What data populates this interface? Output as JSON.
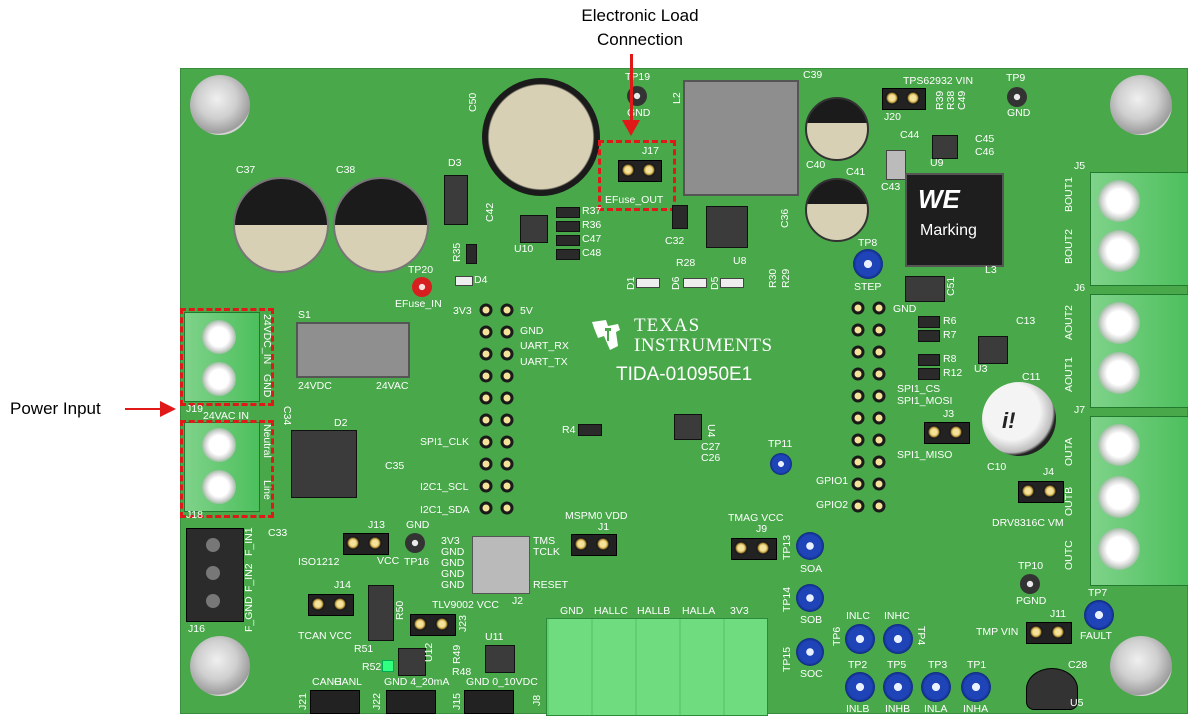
{
  "annotations": {
    "electronic_load_line1": "Electronic Load",
    "electronic_load_line2": "Connection",
    "power_input": "Power Input"
  },
  "board": {
    "vendor_line1": "TEXAS",
    "vendor_line2": "INSTRUMENTS",
    "board_id": "TIDA-010950E1",
    "inductor_brand": "WE",
    "inductor_marking": "Marking",
    "cap_logo": "i!"
  },
  "silkscreen": {
    "C37": "C37",
    "C38": "C38",
    "C50": "C50",
    "D3": "D3",
    "TP19": "TP19",
    "GND_tp19": "GND",
    "L2": "L2",
    "C39": "C39",
    "TPS62932_VIN": "TPS62932 VIN",
    "TP9": "TP9",
    "GND_tp9": "GND",
    "J20": "J20",
    "R39": "R39",
    "R38": "R38",
    "C49": "C49",
    "C44": "C44",
    "C45": "C45",
    "C46": "C46",
    "U9": "U9",
    "C40": "C40",
    "C41": "C41",
    "C43": "C43",
    "J17": "J17",
    "EFuse_OUT": "EFuse_OUT",
    "C42": "C42",
    "R37": "R37",
    "R36": "R36",
    "C47": "C47",
    "C48": "C48",
    "U10": "U10",
    "C32": "C32",
    "C36": "C36",
    "U8": "U8",
    "R28": "R28",
    "R30": "R30",
    "R29": "R29",
    "TP8": "TP8",
    "STEP": "STEP",
    "L3": "L3",
    "C51": "C51",
    "R35": "R35",
    "D4": "D4",
    "TP20": "TP20",
    "EFuse_IN": "EFuse_IN",
    "D1": "D1",
    "D6": "D6",
    "D5": "D5",
    "J5": "J5",
    "BOUT1": "BOUT1",
    "BOUT2": "BOUT2",
    "J6": "J6",
    "AOUT2": "AOUT2",
    "AOUT1": "AOUT1",
    "J7": "J7",
    "OUTA": "OUTA",
    "OUTB": "OUTB",
    "OUTC": "OUTC",
    "S1": "S1",
    "24VDC": "24VDC",
    "24VAC": "24VAC",
    "24VDC_IN": "24VDC_IN",
    "GND_J19": "GND",
    "J19": "J19",
    "24VAC_IN": "24VAC IN",
    "Neutral": "Neutral",
    "Line": "Line",
    "J18": "J18",
    "C34": "C34",
    "D2": "D2",
    "C35": "C35",
    "C33": "C33",
    "3V3": "3V3",
    "5V": "5V",
    "GND_hdr": "GND",
    "UART_RX": "UART_RX",
    "UART_TX": "UART_TX",
    "SPI1_CLK": "SPI1_CLK",
    "I2C1_SCL": "I2C1_SCL",
    "I2C1_SDA": "I2C1_SDA",
    "R4": "R4",
    "U4": "U4",
    "C27": "C27",
    "C26": "C26",
    "TP11": "TP11",
    "GND_right": "GND",
    "R6": "R6",
    "R7": "R7",
    "R8": "R8",
    "R12": "R12",
    "C13": "C13",
    "U3": "U3",
    "C11": "C11",
    "SPI1_CS": "SPI1_CS",
    "SPI1_MOSI": "SPI1_MOSI",
    "J3": "J3",
    "SPI1_MISO": "SPI1_MISO",
    "C10": "C10",
    "GPIO1": "GPIO1",
    "GPIO2": "GPIO2",
    "J4": "J4",
    "DRV8316C_VM": "DRV8316C VM",
    "J16": "J16",
    "F_GND": "F_GND",
    "F_IN2": "F_IN2",
    "F_IN1": "F_IN1",
    "J13": "J13",
    "VCC_j13": "VCC",
    "GND_tp16": "GND",
    "TP16": "TP16",
    "ISO1212": "ISO1212",
    "J14": "J14",
    "TCAN_VCC": "TCAN VCC",
    "R50": "R50",
    "R51": "R51",
    "R52": "R52",
    "U12": "U12",
    "J23": "J23",
    "TLV9002_VCC": "TLV9002 VCC",
    "R49": "R49",
    "R48": "R48",
    "U11": "U11",
    "J21": "J21",
    "CANH": "CANH",
    "CANL": "CANL",
    "J22": "J22",
    "GND_4_20mA": "GND 4_20mA",
    "J15": "J15",
    "GND_0_10VDC": "GND 0_10VDC",
    "3V3_j2": "3V3",
    "GND1": "GND",
    "GND2": "GND",
    "GND3": "GND",
    "GND4": "GND",
    "TMS": "TMS",
    "TCLK": "TCLK",
    "RESET": "RESET",
    "J2": "J2",
    "MSPM0_VDD": "MSPM0 VDD",
    "J1": "J1",
    "J8": "J8",
    "hall_gnd": "GND",
    "HALLC": "HALLC",
    "HALLB": "HALLB",
    "HALLA": "HALLA",
    "hall_3v3": "3V3",
    "TMAG_VCC": "TMAG VCC",
    "J9": "J9",
    "TP13": "TP13",
    "SOA": "SOA",
    "TP14": "TP14",
    "SOB": "SOB",
    "TP15": "TP15",
    "SOC": "SOC",
    "TP6": "TP6",
    "INLC": "INLC",
    "INHC": "INHC",
    "TP4": "TP4",
    "TP2": "TP2",
    "TP5": "TP5",
    "TP3": "TP3",
    "TP1": "TP1",
    "INLB": "INLB",
    "INHB": "INHB",
    "INLA": "INLA",
    "INHA": "INHA",
    "TP10": "TP10",
    "PGND": "PGND",
    "TP7": "TP7",
    "FAULT": "FAULT",
    "TMP_VIN": "TMP VIN",
    "J11": "J11",
    "C28": "C28",
    "U5": "U5"
  },
  "colors": {
    "pcb": "#49a84a",
    "callout": "#e01818",
    "tp_blue": "#1f44b8"
  }
}
